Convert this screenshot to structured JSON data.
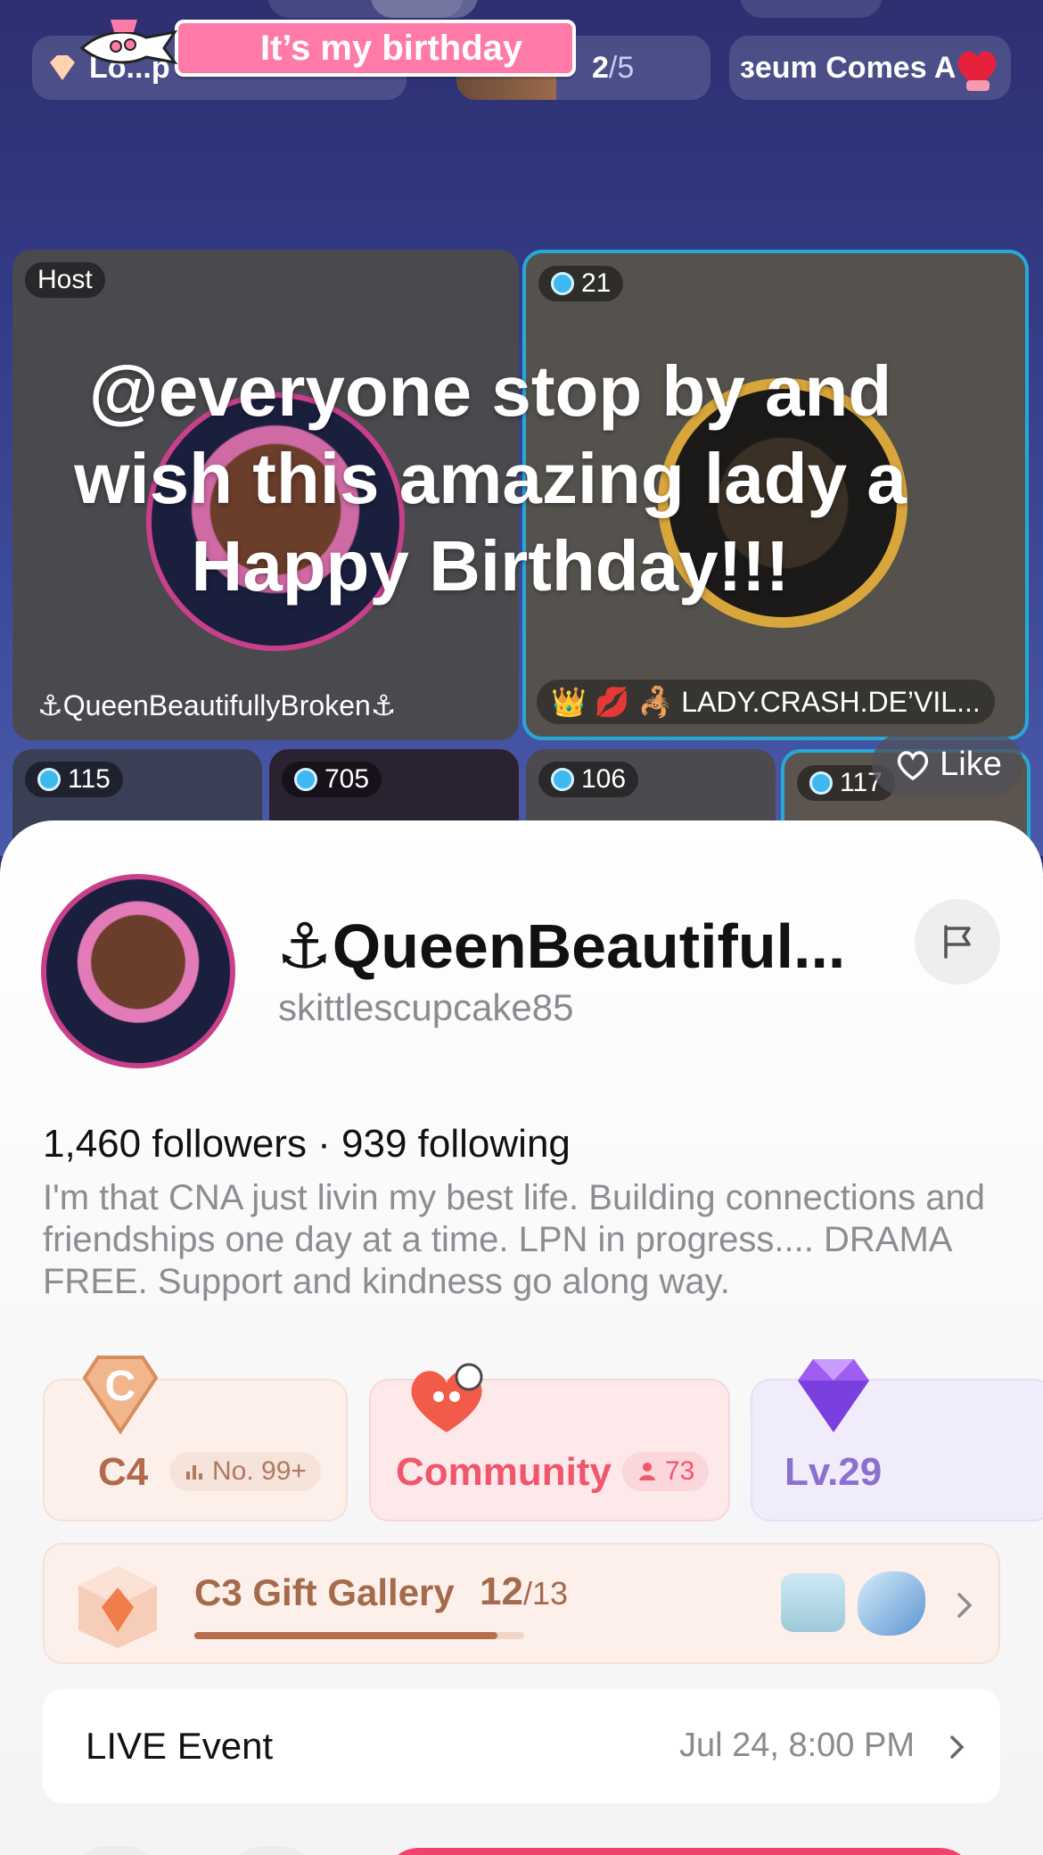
{
  "header": {
    "birthday_banner": "It’s my birthday",
    "left_chip": "Lo...p",
    "goal_current": "2",
    "goal_total": "/5",
    "right_chip": "ɜeum Comes A"
  },
  "overlay_message": "@everyone stop by and wish this amazing lady a Happy Birthday!!!",
  "tiles": {
    "host": {
      "badge": "Host",
      "name": "⚓QueenBeautifullyBroken⚓"
    },
    "guest": {
      "badge": "21",
      "name": "👑 💋 🦂 LADY.CRASH.DE’VIL..."
    },
    "small": [
      "115",
      "705",
      "106",
      "117"
    ]
  },
  "like_label": "Like",
  "profile": {
    "display_name": "⚓QueenBeautiful...",
    "username": "skittlescupcake85",
    "stats": "1,460 followers · 939 following",
    "bio": "I'm that CNA just livin my best life. Building connections and friendships one day at a time. LPN in progress.... DRAMA FREE. Support and kindness go along way."
  },
  "cards": {
    "rank": {
      "title": "C4",
      "tag": "No. 99+"
    },
    "community": {
      "title": "Community",
      "tag": "73"
    },
    "level": {
      "title": "Lv.29"
    }
  },
  "gallery": {
    "title": "C3 Gift Gallery",
    "count": "12",
    "total": "/13",
    "progress": 0.92
  },
  "live_event": {
    "title": "LIVE Event",
    "date": "Jul 24, 8:00 PM"
  },
  "colors": {
    "accent_pink": "#f0426b",
    "cyan_border": "#27a9d8",
    "rank_brown": "#b36a4a",
    "community_red": "#f0566c",
    "level_purple": "#8d6fd0"
  }
}
